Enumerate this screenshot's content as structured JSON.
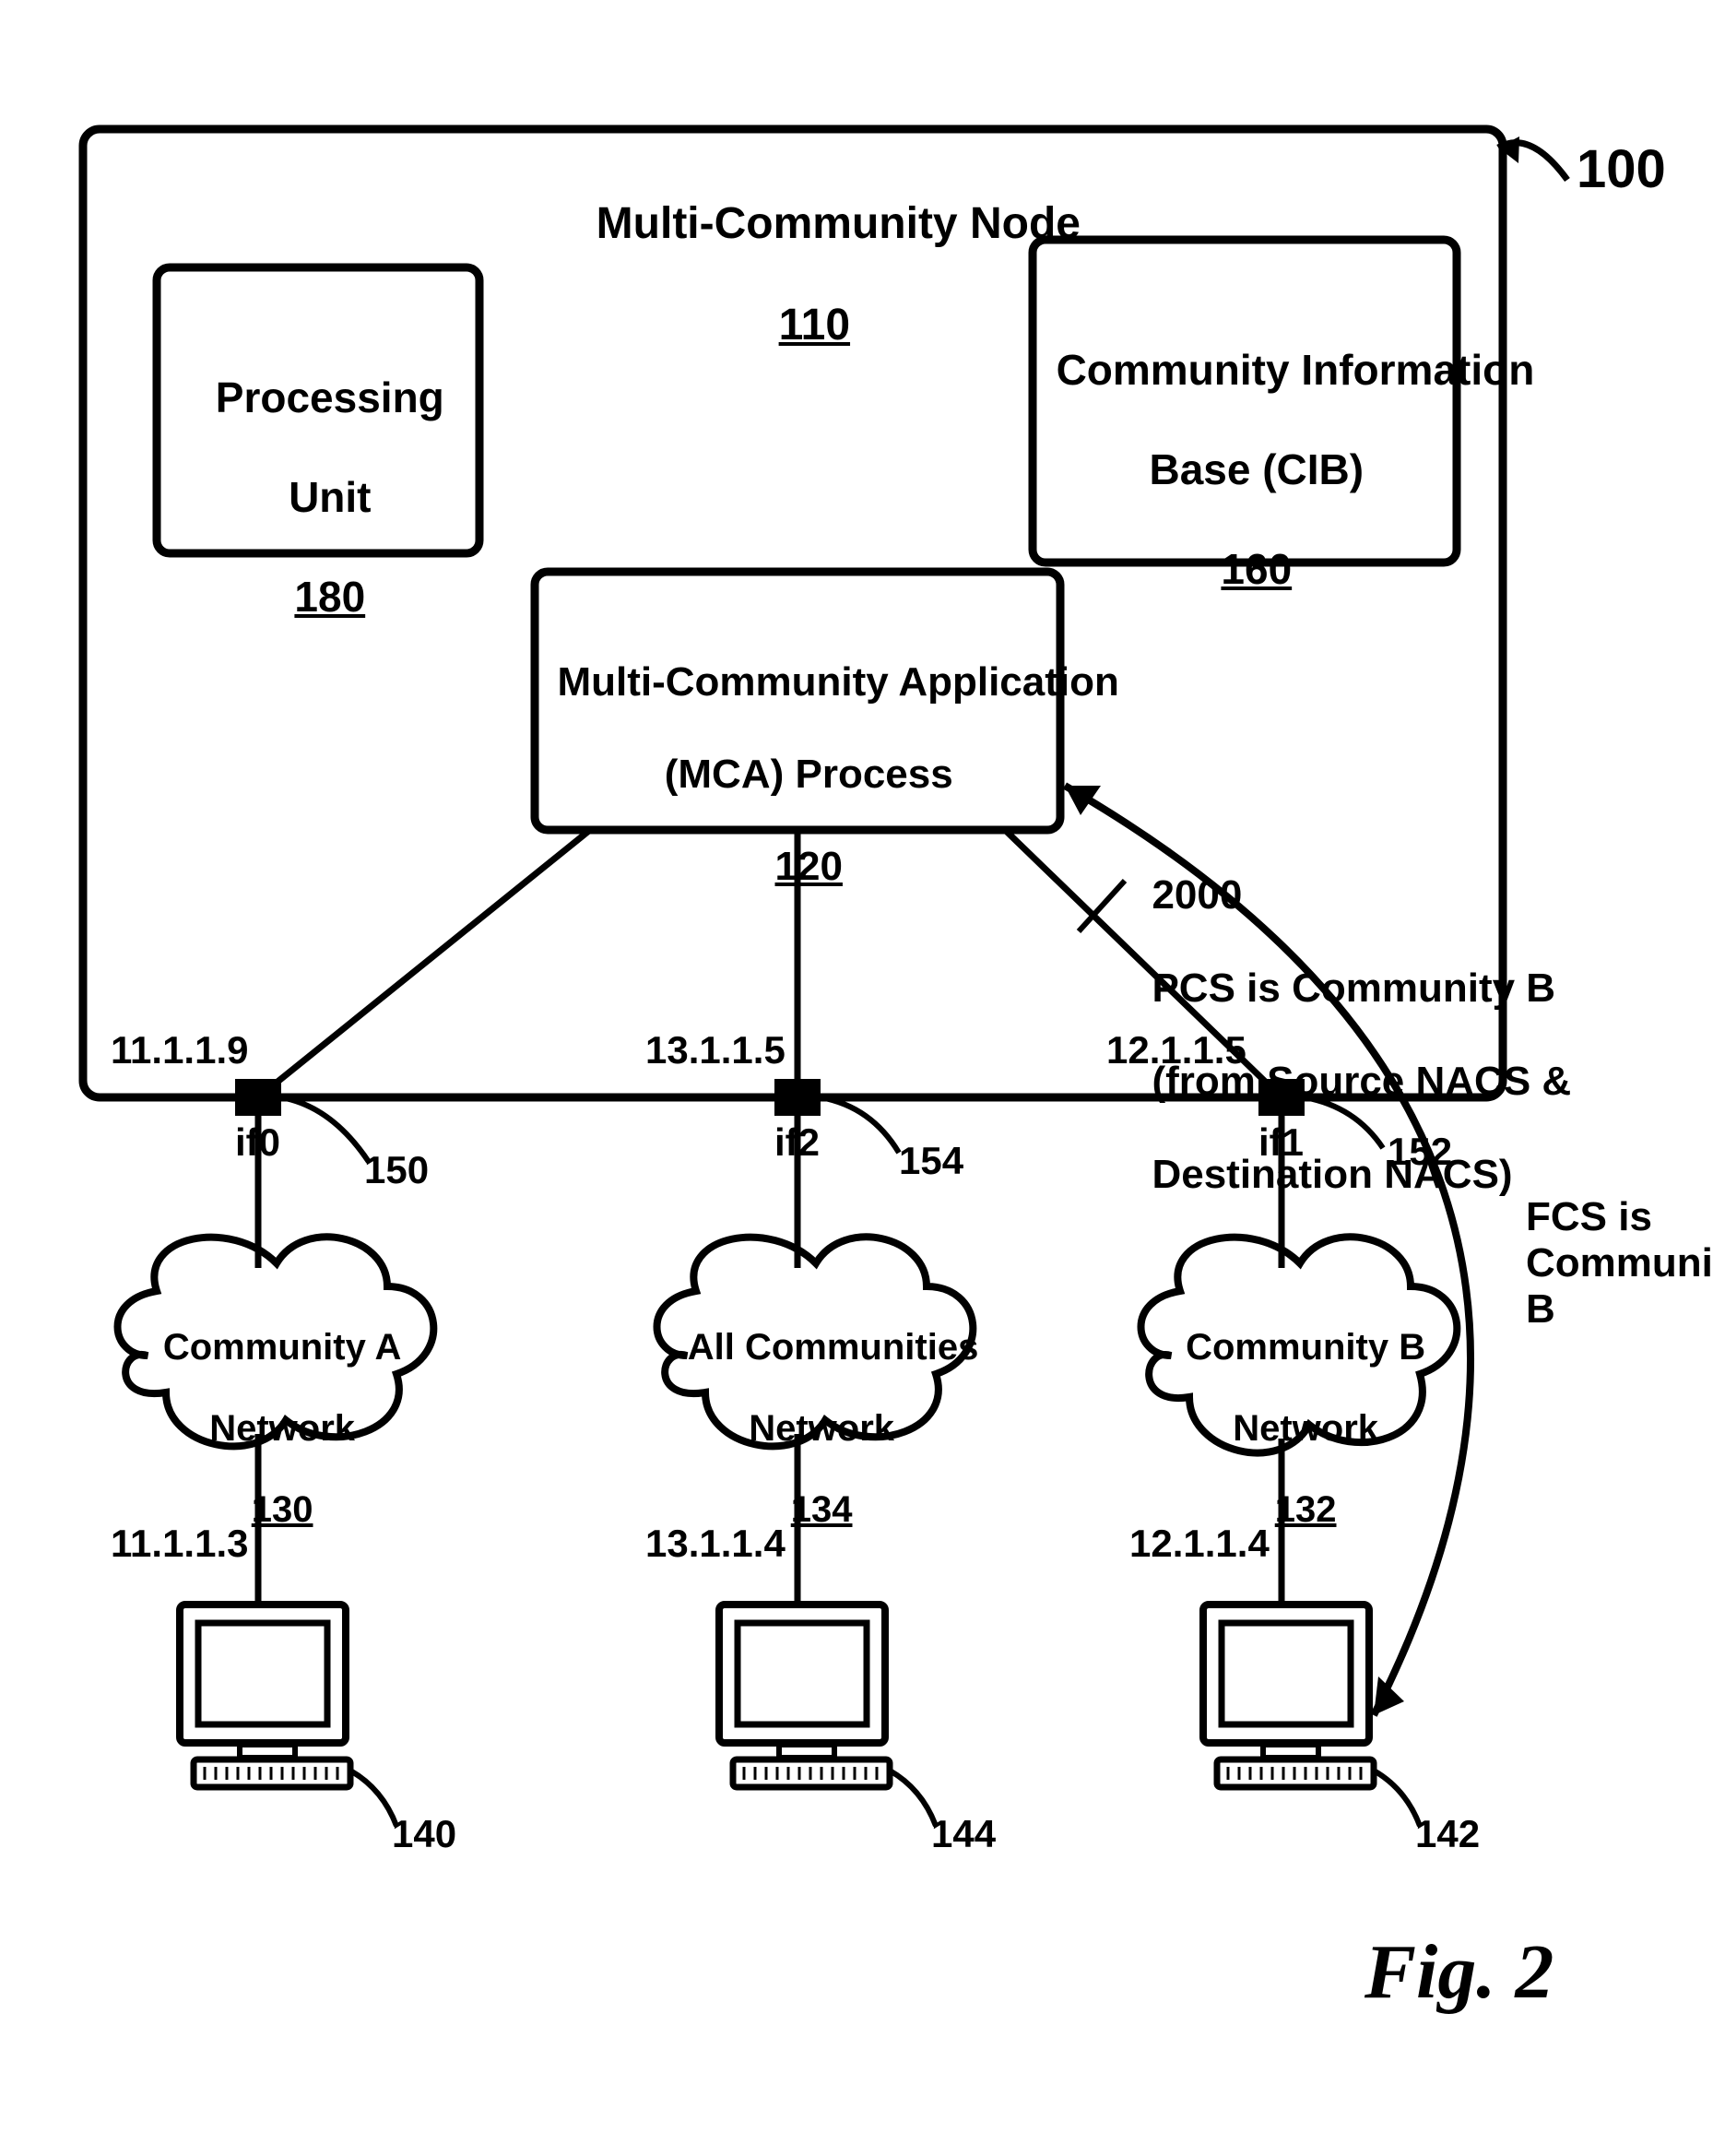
{
  "figure": {
    "system_ref": "100",
    "fig_label": "Fig. 2"
  },
  "node": {
    "title1": "Multi-Community Node",
    "title_ref": "110",
    "processing_unit": {
      "line1": "Processing",
      "line2": "Unit",
      "ref": "180"
    },
    "cib": {
      "line1": "Community Information",
      "line2": "Base (CIB)",
      "ref": "160"
    },
    "mca": {
      "line1": "Multi-Community Application",
      "line2": "(MCA) Process",
      "ref": "120"
    }
  },
  "interfaces": {
    "if0": {
      "name": "if0",
      "ip": "11.1.1.9",
      "port_ref": "150"
    },
    "if2": {
      "name": "if2",
      "ip": "13.1.1.5",
      "port_ref": "154"
    },
    "if1": {
      "name": "if1",
      "ip": "12.1.1.5",
      "port_ref": "152"
    }
  },
  "networks": {
    "a": {
      "line1": "Community A",
      "line2": "Network",
      "ref": "130"
    },
    "all": {
      "line1": "All Communities",
      "line2": "Network",
      "ref": "134"
    },
    "b": {
      "line1": "Community B",
      "line2": "Network",
      "ref": "132"
    }
  },
  "hosts": {
    "a": {
      "ip": "11.1.1.3",
      "ref": "140"
    },
    "all": {
      "ip": "13.1.1.4",
      "ref": "144"
    },
    "b": {
      "ip": "12.1.1.4",
      "ref": "142"
    }
  },
  "annotations": {
    "pcs_ref": "2000",
    "pcs_line1": "PCS is Community B",
    "pcs_line2": "(from Source NACS &",
    "pcs_line3": "Destination NACS)",
    "fcs": "FCS is Community B"
  }
}
